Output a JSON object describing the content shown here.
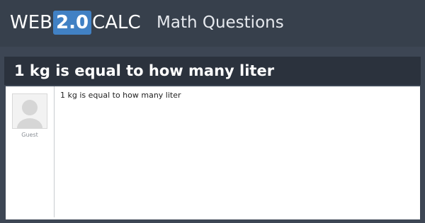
{
  "header": {
    "logo": {
      "prefix": "WEB",
      "version": "2.0",
      "suffix": "CALC"
    },
    "section_title": "Math Questions"
  },
  "page": {
    "title": "1 kg is equal to how many liter"
  },
  "question": {
    "author": "Guest",
    "avatar_icon": "default-user-avatar-icon",
    "text": "1 kg is equal to how many liter"
  },
  "colors": {
    "background": "#3d4654",
    "header": "#37404c",
    "title_bar": "#2b323d",
    "logo_accent": "#4181c4",
    "panel": "#ffffff"
  }
}
